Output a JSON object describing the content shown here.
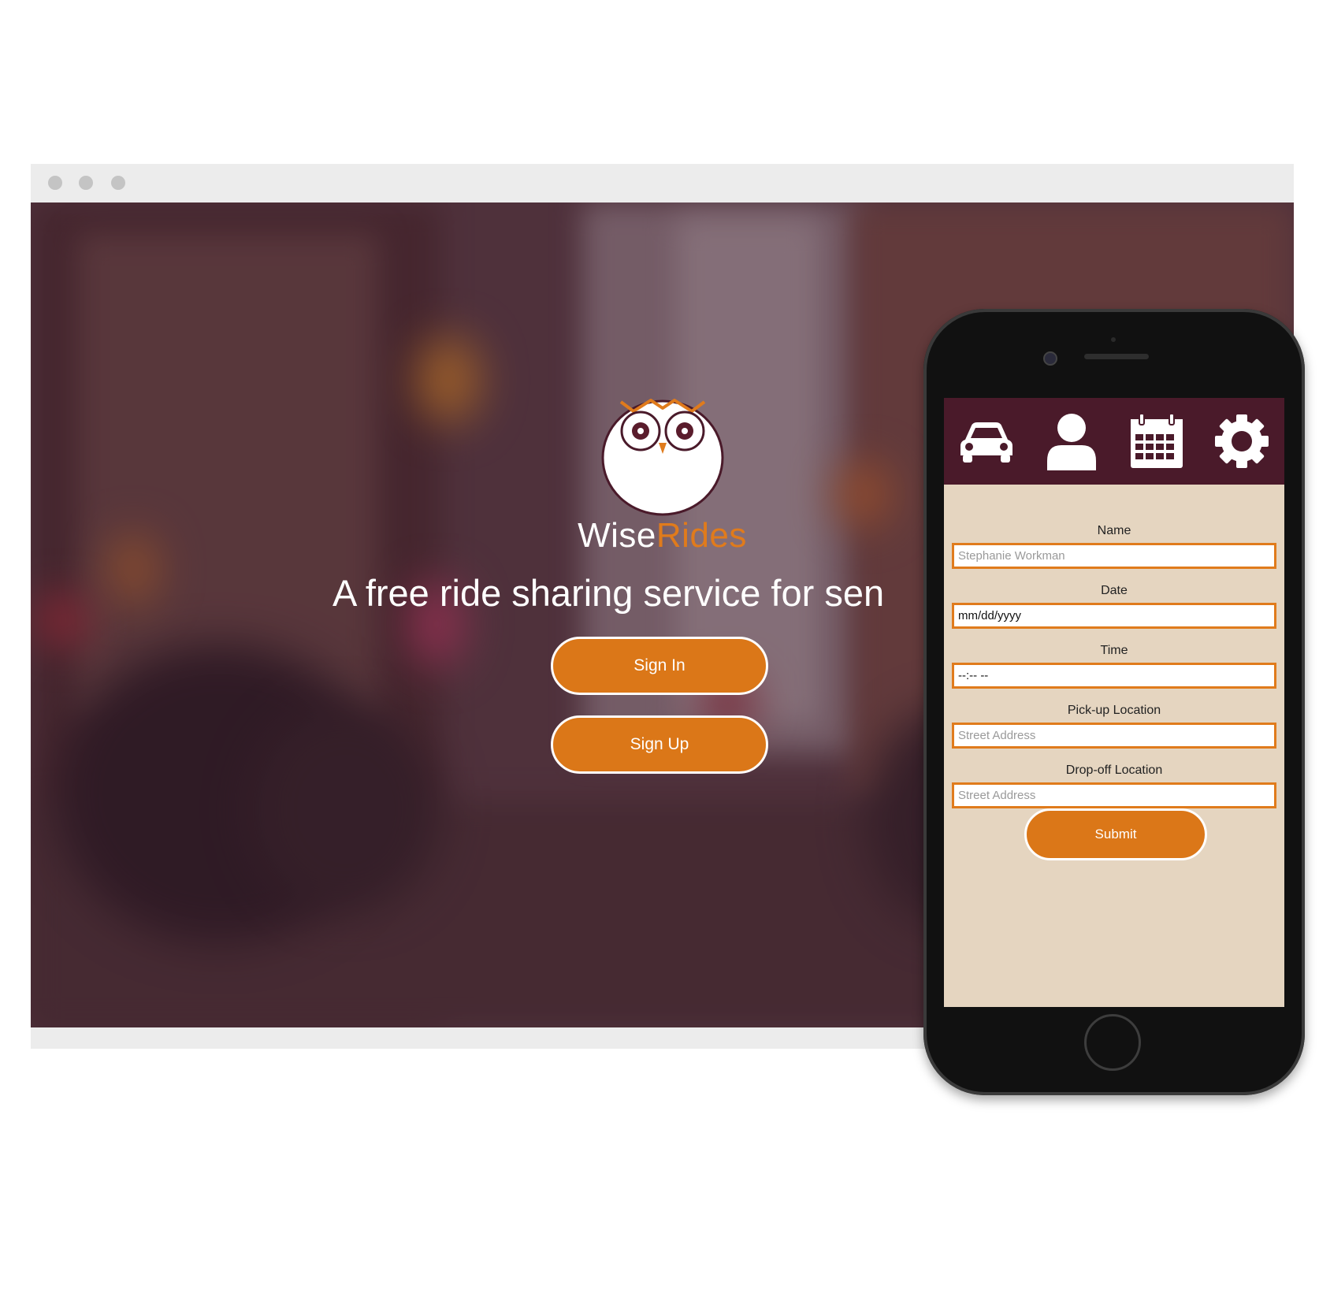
{
  "brand": {
    "name_part1": "Wise",
    "name_part2": "Rides",
    "accent_color": "#e07b1c",
    "dark_color": "#4a1a2a"
  },
  "hero": {
    "tagline": "A free ride sharing service for sen"
  },
  "buttons": {
    "sign_in": "Sign In",
    "sign_up": "Sign Up"
  },
  "app": {
    "nav": [
      {
        "icon": "car-icon"
      },
      {
        "icon": "user-icon"
      },
      {
        "icon": "calendar-icon"
      },
      {
        "icon": "gear-icon"
      }
    ],
    "form": {
      "name_label": "Name",
      "name_placeholder": "Stephanie Workman",
      "date_label": "Date",
      "date_placeholder": "mm/dd/yyyy",
      "time_label": "Time",
      "time_placeholder": "--:-- --",
      "pickup_label": "Pick-up Location",
      "pickup_placeholder": "Street Address",
      "dropoff_label": "Drop-off Location",
      "dropoff_placeholder": "Street Address",
      "submit": "Submit"
    }
  }
}
